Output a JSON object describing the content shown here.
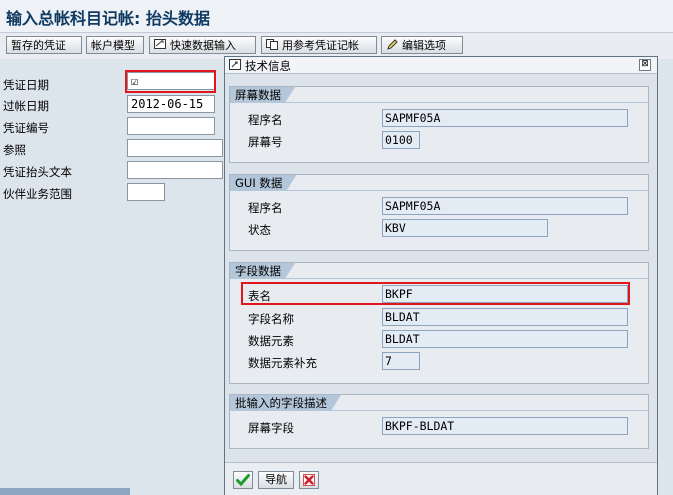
{
  "window": {
    "title": "输入总帐科目记帐: 抬头数据"
  },
  "toolbar": {
    "held_document": "暂存的凭证",
    "account_model": "帐户模型",
    "fast_entry": "快速数据输入",
    "post_with_reference": "用参考凭证记帐",
    "editing_options": "编辑选项"
  },
  "header_form": {
    "document_date": {
      "label": "凭证日期",
      "value": "☑"
    },
    "posting_date": {
      "label": "过帐日期",
      "value": "2012-06-15"
    },
    "document_number": {
      "label": "凭证编号",
      "value": ""
    },
    "reference": {
      "label": "参照",
      "value": ""
    },
    "header_text": {
      "label": "凭证抬头文本",
      "value": ""
    },
    "partner_business_area": {
      "label": "伙伴业务范围",
      "value": ""
    }
  },
  "dialog": {
    "title": "技术信息",
    "close_glyph": "⊠",
    "screen_data": {
      "header": "屏幕数据",
      "program_label": "程序名",
      "program_value": "SAPMF05A",
      "screen_no_label": "屏幕号",
      "screen_no_value": "0100"
    },
    "gui_data": {
      "header": "GUI 数据",
      "program_label": "程序名",
      "program_value": "SAPMF05A",
      "status_label": "状态",
      "status_value": "KBV"
    },
    "field_data": {
      "header": "字段数据",
      "table_label": "表名",
      "table_value": "BKPF",
      "field_label": "字段名称",
      "field_value": "BLDAT",
      "element_label": "数据元素",
      "element_value": "BLDAT",
      "supplement_label": "数据元素补充",
      "supplement_value": "7"
    },
    "batch_input": {
      "header": "批输入的字段描述",
      "screen_field_label": "屏幕字段",
      "screen_field_value": "BKPF-BLDAT"
    },
    "footer": {
      "navigation": "导航"
    }
  },
  "colors": {
    "highlight": "#e0161d",
    "title": "#103a62",
    "group_header": "#b4c6d9"
  }
}
